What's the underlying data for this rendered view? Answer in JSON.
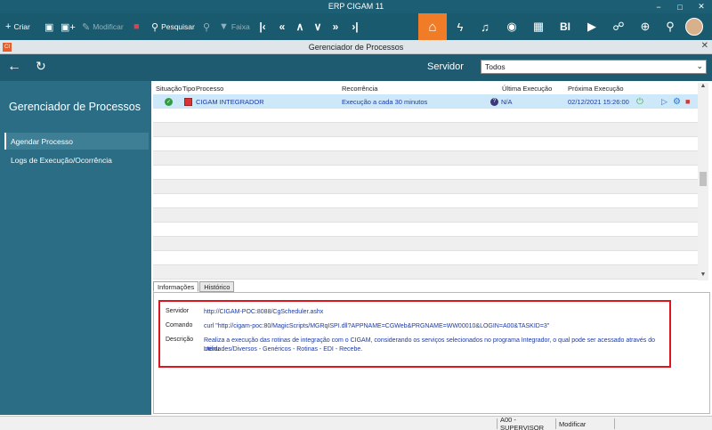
{
  "window": {
    "title": "ERP CIGAM 11",
    "controls": [
      "−",
      "□",
      "✕"
    ]
  },
  "toolbar": {
    "criar": "Criar",
    "modificar": "Modificar",
    "pesquisar": "Pesquisar",
    "faixa": "Faixa",
    "bi_label": "BI"
  },
  "subwindow": {
    "title": "Gerenciador de Processos",
    "logo_text": "CI"
  },
  "sidebar": {
    "heading": "Gerenciador de Processos",
    "items": [
      {
        "label": "Agendar Processo"
      },
      {
        "label": "Logs de Execução/Ocorrência"
      }
    ]
  },
  "filter": {
    "label": "Servidor",
    "value": "Todos"
  },
  "grid": {
    "columns": [
      "Situação",
      "Tipo",
      "Processo",
      "Recorrência",
      "Última Execução",
      "Próxima Execução"
    ],
    "rows": [
      {
        "processo": "CIGAM INTEGRADOR",
        "recorrencia": "Execução a cada 30 minutos",
        "ultima": "N/A",
        "proxima": "02/12/2021 15:26:00"
      }
    ]
  },
  "tabs": [
    "Informações",
    "Histórico"
  ],
  "details": {
    "servidor_label": "Servidor",
    "servidor_value": "http://CIGAM-POC:8088/CgScheduler.ashx",
    "comando_label": "Comando",
    "comando_value": "curl \"http://cigam-poc:80/MagicScripts/MGRqISPI.dll?APPNAME=CGWeb&PRGNAME=WW00010&LOGIN=A00&TASKID=3\"",
    "descricao_label": "Descrição",
    "descricao_line1": "Realiza a execução das rotinas de integração com o CIGAM, considerando os serviços selecionados no programa Integrador, o qual pode ser acessado através do menu",
    "descricao_line2": "Utilidades/Diversos - Genéricos - Rotinas - EDI - Recebe."
  },
  "statusbar": {
    "user": "A00 - SUPERVISOR",
    "mode": "Modificar"
  },
  "colors": {
    "accent": "#f07c28",
    "header": "#1a5a6e",
    "sidebar": "#2a6d85",
    "highlight_box": "#e0141c"
  }
}
